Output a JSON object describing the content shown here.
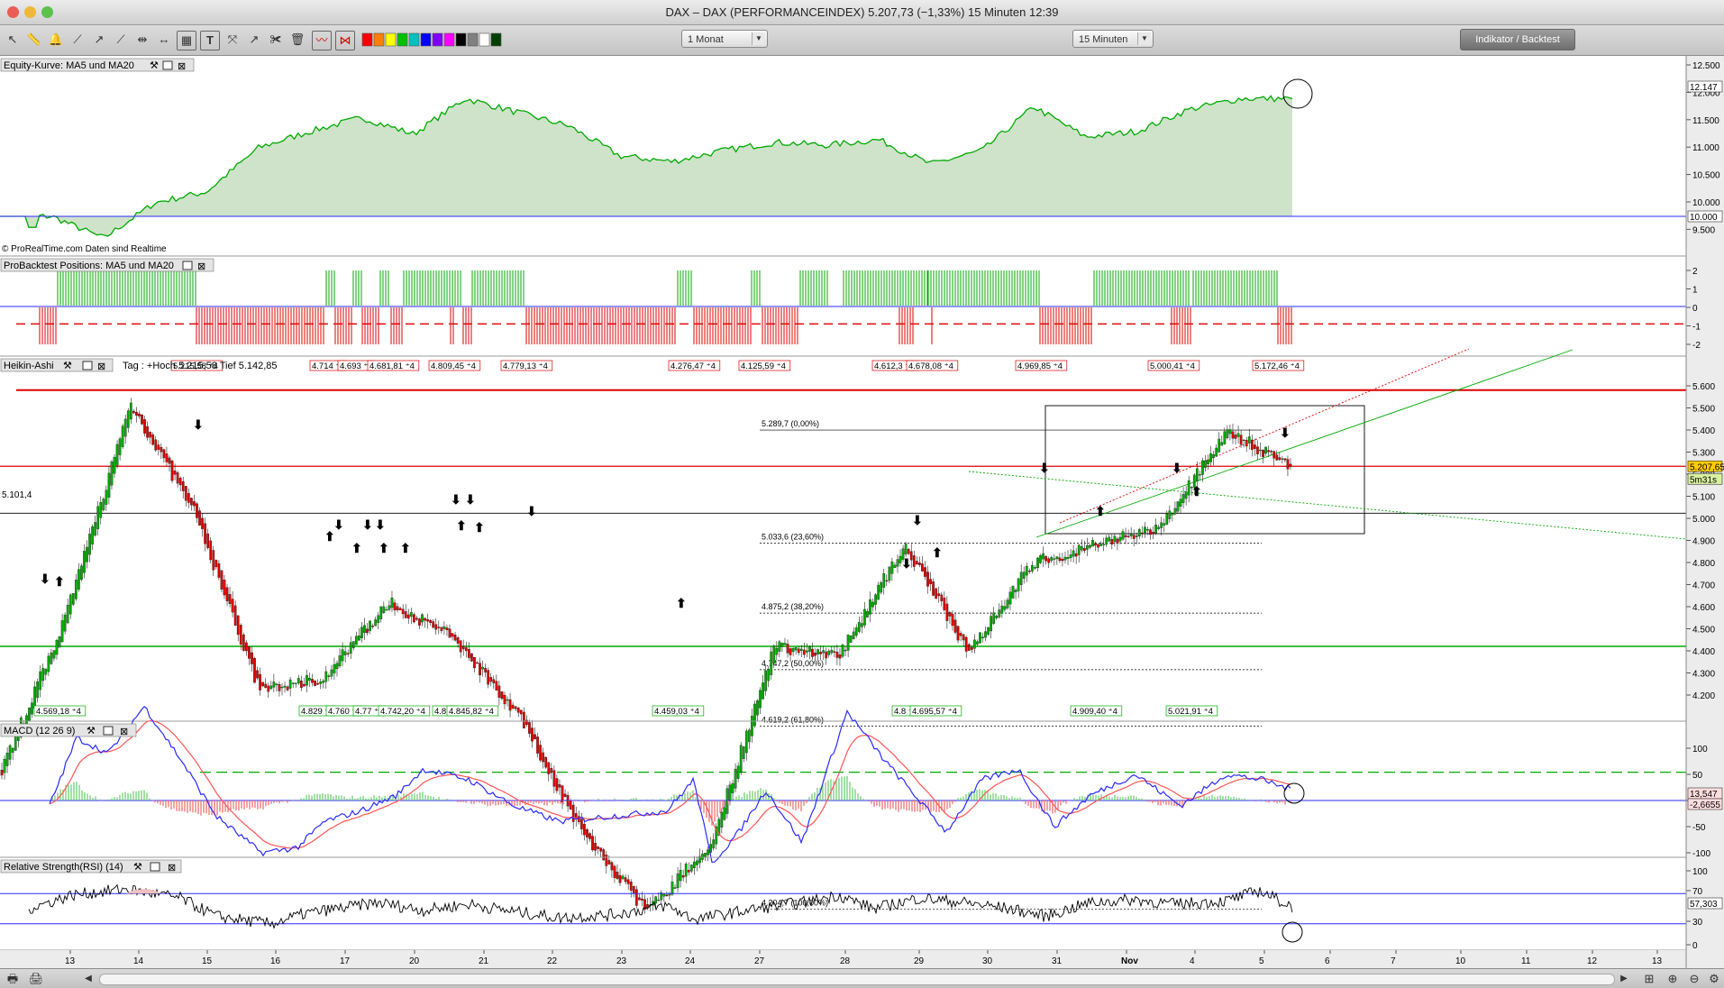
{
  "window": {
    "title": "DAX – DAX (PERFORMANCEINDEX)    5.207,73 (−1,33%)    15 Minuten  12:39"
  },
  "toolbar": {
    "period": "1 Monat",
    "interval": "15 Minuten",
    "indicator_button": "Indikator / Backtest"
  },
  "colors": {
    "equity_fill": "#cfe3ca",
    "up": "#00aa00",
    "down": "#dd0000",
    "baseline": "#2a2aff"
  },
  "x_axis": {
    "labels": [
      "13",
      "14",
      "15",
      "16",
      "17",
      "20",
      "21",
      "22",
      "23",
      "24",
      "27",
      "28",
      "29",
      "30",
      "31",
      "Nov",
      "4",
      "5",
      "6",
      "7",
      "10",
      "11",
      "12",
      "13"
    ]
  },
  "panels": {
    "equity": {
      "title": "Equity-Kurve: MA5 und MA20",
      "copyright": "© ProRealTime.com  Daten sind Realtime",
      "ticks": [
        "12.500",
        "12.000",
        "11.500",
        "11.000",
        "10.500",
        "10.000",
        "9.500"
      ],
      "badges": [
        "12.147",
        "10.000"
      ]
    },
    "positions": {
      "title": "ProBacktest Positions: MA5 und MA20",
      "ticks": [
        "2",
        "1",
        "0",
        "-1",
        "-2"
      ]
    },
    "price": {
      "title": "Heikin-Ashi",
      "info": "Tag : +Hoch 5.215,58  Tief 5.142,85",
      "ticks": [
        "5.600",
        "5.500",
        "5.400",
        "5.300",
        "5.200",
        "5.100",
        "5.000",
        "4.900",
        "4.800",
        "4.700",
        "4.600",
        "4.500",
        "4.400",
        "4.300",
        "4.200"
      ],
      "price_badge": "5.207,65",
      "timer_badge": "5m31s",
      "level_label": "5.101,4",
      "high_labels": [
        "5.215,58",
        "4.714",
        "4.693",
        "4.681,81",
        "4.809,45",
        "4.779,13",
        "4.276,47",
        "4.125,59",
        "4.612,3",
        "4.678,08",
        "4.969,85",
        "5.000,41",
        "5.172,46"
      ],
      "low_labels": [
        "4.569,18",
        "4.829",
        "4.760",
        "4.77",
        "4.742,20",
        "4.8",
        "4.845,82",
        "4.459,03",
        "4.8",
        "4.695,57",
        "4.909,40",
        "5.021,91"
      ],
      "fib": [
        "5.289,7 (0,00%)",
        "5.033,6 (23,60%)",
        "4.875,2 (38,20%)",
        "4.747,2 (50,00%)",
        "4.619,2 (61,80%)",
        "4.204,7 (100,00%)"
      ]
    },
    "macd": {
      "title": "MACD (12 26 9)",
      "ticks": [
        "100",
        "50",
        "0",
        "-50",
        "-100"
      ],
      "badges": [
        "13,547",
        "-2,6655"
      ]
    },
    "rsi": {
      "title": "Relative Strength(RSI) (14)",
      "ticks": [
        "100",
        "70",
        "30",
        "0"
      ],
      "badges": [
        "57,303",
        "70",
        "30"
      ]
    }
  },
  "chart_data": {
    "type": "line",
    "series": [
      {
        "name": "Equity-Kurve: MA5 und MA20",
        "x": [
          0,
          0.04,
          0.08,
          0.12,
          0.16,
          0.2,
          0.24,
          0.28,
          0.32,
          0.36,
          0.4,
          0.44,
          0.48,
          0.52,
          0.56,
          0.6,
          0.64,
          0.68,
          0.72,
          0.76,
          0.8,
          0.84,
          0.88,
          0.92,
          0.96,
          1.0
        ],
        "values": [
          10000,
          10000,
          9600,
          10250,
          10450,
          11250,
          11550,
          11800,
          11500,
          12150,
          11900,
          11650,
          11100,
          11000,
          11200,
          11350,
          11300,
          11400,
          10950,
          11200,
          12000,
          11450,
          11550,
          11950,
          12150,
          12147
        ]
      },
      {
        "name": "Heikin-Ashi",
        "x": [
          0,
          0.05,
          0.1,
          0.15,
          0.2,
          0.25,
          0.3,
          0.35,
          0.4,
          0.45,
          0.5,
          0.55,
          0.6,
          0.65,
          0.7,
          0.75,
          0.8,
          0.85,
          0.9,
          0.95,
          1.0
        ],
        "values": [
          4520,
          4870,
          5350,
          5100,
          4700,
          4730,
          4900,
          4820,
          4650,
          4380,
          4200,
          4350,
          4800,
          4780,
          5030,
          4790,
          4990,
          5030,
          5070,
          5290,
          5207.65
        ]
      }
    ],
    "levels": {
      "red_dashed": 5530,
      "red": [
        5380,
        5207.65
      ],
      "black": 5101.4,
      "green": 4800,
      "green_dashed": 4515
    },
    "rsi_bands": [
      70,
      30
    ],
    "macd_zero": 0
  }
}
